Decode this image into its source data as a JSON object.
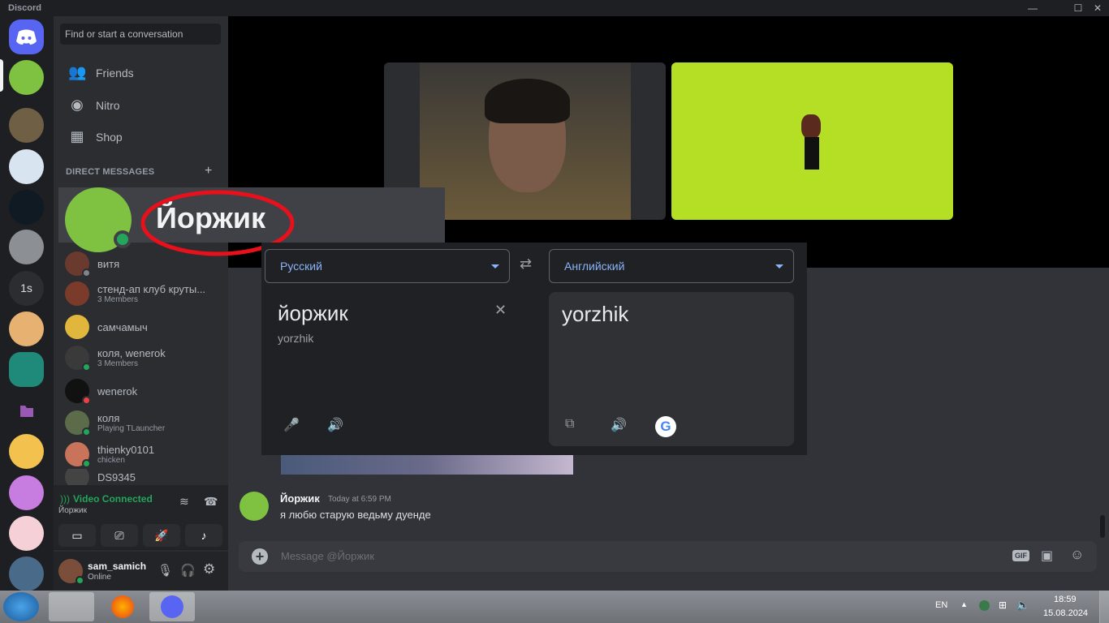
{
  "window": {
    "title": "Discord",
    "min": "—",
    "max": "☐",
    "close": "✕"
  },
  "sidebar": {
    "search_placeholder": "Find or start a conversation",
    "nav": [
      {
        "label": "Friends",
        "icon": "friends-icon"
      },
      {
        "label": "Nitro",
        "icon": "nitro-icon"
      },
      {
        "label": "Shop",
        "icon": "shop-icon"
      }
    ],
    "dm_header": "DIRECT MESSAGES",
    "dms": [
      {
        "name": "витя",
        "sub": "",
        "status": "offline"
      },
      {
        "name": "стенд-ап клуб круты...",
        "sub": "3 Members",
        "status": ""
      },
      {
        "name": "самчамыч",
        "sub": "",
        "status": ""
      },
      {
        "name": "коля, wenerok",
        "sub": "3 Members",
        "status": ""
      },
      {
        "name": "wenerok",
        "sub": "",
        "status": "dnd"
      },
      {
        "name": "коля",
        "sub": "Playing TLauncher",
        "status": "online"
      },
      {
        "name": "thienky0101",
        "sub": "chicken",
        "status": "online"
      },
      {
        "name": "DS9345",
        "sub": "",
        "status": ""
      }
    ],
    "voice": {
      "title": "Video Connected",
      "channel": "Йоржик"
    },
    "user": {
      "name": "sam_samich",
      "status": "Online"
    }
  },
  "highlight": {
    "name": "Йоржик"
  },
  "translator": {
    "source_lang": "Русский",
    "target_lang": "Английский",
    "source_text": "йоржик",
    "transliteration": "yorzhik",
    "translation": "yorzhik",
    "clear": "✕"
  },
  "chat": {
    "author": "Йоржик",
    "time": "Today at 6:59 PM",
    "text": "я любю старую ведьму дуенде",
    "composer_placeholder": "Message @Йоржик"
  },
  "taskbar": {
    "lang": "EN",
    "time": "18:59",
    "date": "15.08.2024"
  }
}
